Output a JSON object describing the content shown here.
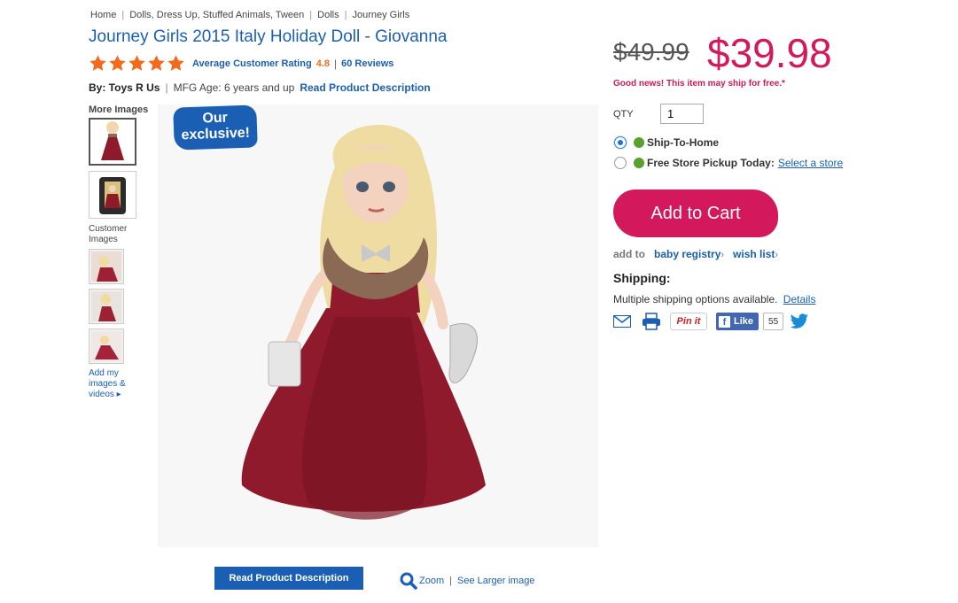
{
  "breadcrumb": [
    "Home",
    "Dolls, Dress Up, Stuffed Animals, Tween",
    "Dolls",
    "Journey Girls"
  ],
  "product": {
    "title": "Journey Girls 2015 Italy Holiday Doll - Giovanna",
    "rating_label": "Average Customer Rating",
    "rating_value": "4.8",
    "stars": 5,
    "reviews": "60 Reviews",
    "by": "By: Toys R Us",
    "mfg_age": "MFG Age: 6 years and up",
    "read_desc_link": "Read Product Description"
  },
  "images": {
    "more_label": "More Images",
    "customer_label": "Customer Images",
    "add_images": "Add my images & videos ▸",
    "badge_line1": "Our",
    "badge_line2": "exclusive!"
  },
  "actions": {
    "read_desc_button": "Read Product Description",
    "zoom": "Zoom",
    "larger": "See Larger image"
  },
  "pricing": {
    "old_price": "$49.99",
    "new_price": "$39.98",
    "ship_note": "Good news! This item may ship for free.*"
  },
  "purchase": {
    "qty_label": "QTY",
    "qty_value": "1",
    "option_ship": "Ship-To-Home",
    "option_pickup": "Free Store Pickup Today:",
    "select_store": "Select a store",
    "add_to_cart": "Add to Cart",
    "add_to_label": "add to",
    "baby_registry": "baby registry",
    "wish_list": "wish list"
  },
  "shipping": {
    "heading": "Shipping:",
    "text": "Multiple shipping options available.",
    "details": "Details"
  },
  "social": {
    "pinit": "Pin it",
    "like": "Like",
    "like_count": "55"
  },
  "colors": {
    "link_blue": "#1a5fb4",
    "price_red": "#d3185b",
    "star_orange": "#f26a1b",
    "dress_red": "#8e1a2c"
  }
}
